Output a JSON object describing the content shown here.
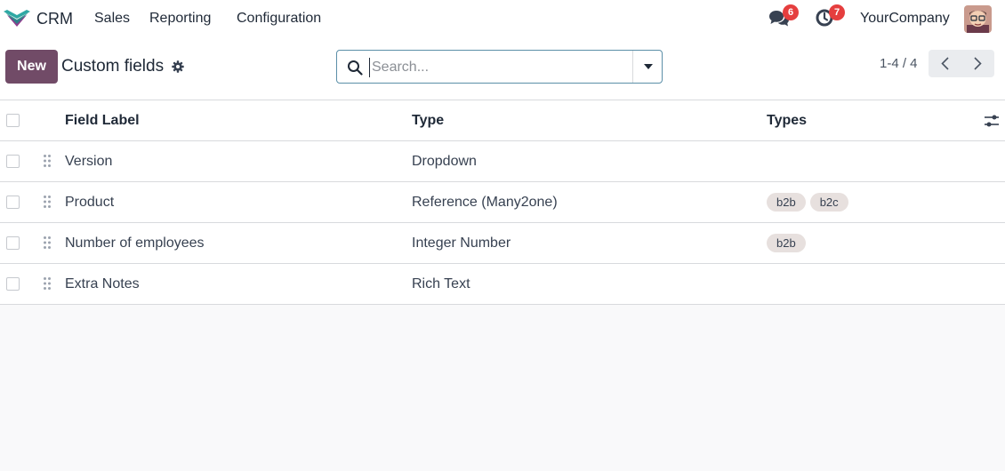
{
  "navbar": {
    "app_name": "CRM",
    "menu": [
      "Sales",
      "Reporting",
      "Configuration"
    ],
    "messages_count": "6",
    "activities_count": "7",
    "company": "YourCompany"
  },
  "control": {
    "new_label": "New",
    "title": "Custom fields",
    "search_placeholder": "Search...",
    "pager": "1-4 / 4"
  },
  "table": {
    "headers": {
      "label": "Field Label",
      "type": "Type",
      "types": "Types"
    },
    "rows": [
      {
        "label": "Version",
        "type": "Dropdown",
        "tags": []
      },
      {
        "label": "Product",
        "type": "Reference (Many2one)",
        "tags": [
          "b2b",
          "b2c"
        ]
      },
      {
        "label": "Number of employees",
        "type": "Integer Number",
        "tags": [
          "b2b"
        ]
      },
      {
        "label": "Extra Notes",
        "type": "Rich Text",
        "tags": []
      }
    ]
  },
  "colors": {
    "brand": "#714b67",
    "badge": "#e53e3e",
    "tag_bg": "#e7e0de"
  }
}
